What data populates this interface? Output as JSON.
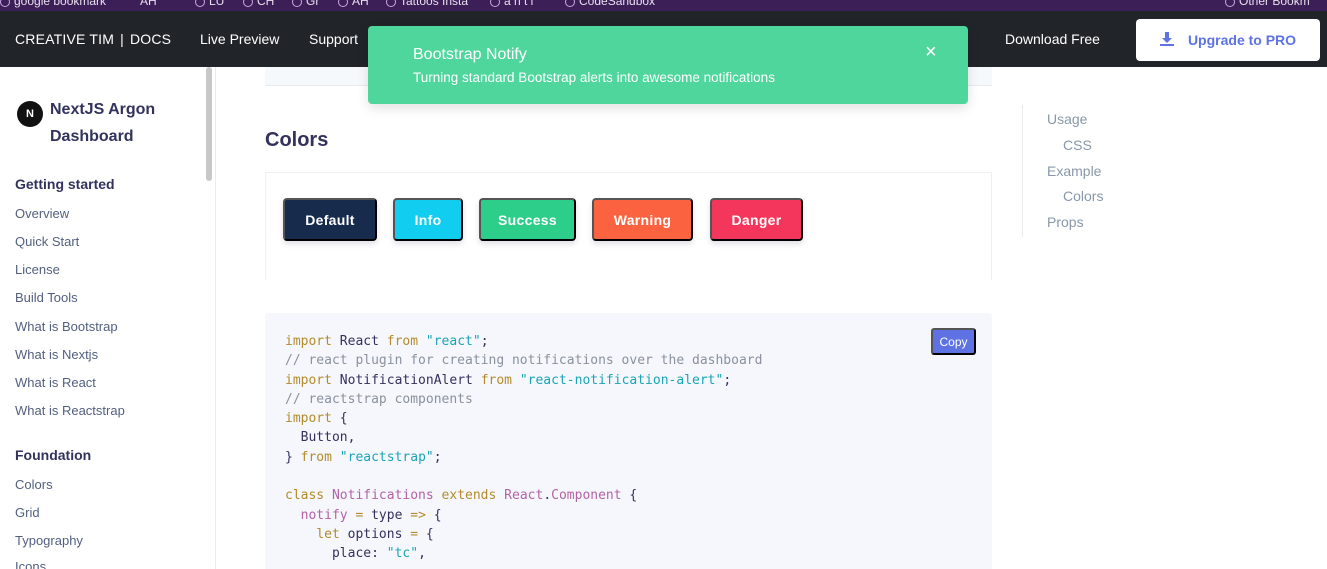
{
  "bookmarks": [
    {
      "label": "google bookmark"
    },
    {
      "label": "AH"
    },
    {
      "label": "LU"
    },
    {
      "label": "CH"
    },
    {
      "label": "Gr"
    },
    {
      "label": "AH"
    },
    {
      "label": "Tattoos Insta"
    },
    {
      "label": "a n t i"
    },
    {
      "label": "CodeSandbox"
    },
    {
      "label": "Other Bookm"
    }
  ],
  "navbar": {
    "brand": "CREATIVE TIM",
    "brand_separator": "|",
    "brand_docs": "DOCS",
    "links": [
      "Live Preview",
      "Support"
    ],
    "download_free": "Download Free",
    "upgrade": "Upgrade to PRO"
  },
  "sidebar": {
    "logo_letter": "N",
    "title": "NextJS Argon Dashboard",
    "sections": [
      {
        "heading": "Getting started",
        "items": [
          "Overview",
          "Quick Start",
          "License",
          "Build Tools",
          "What is Bootstrap",
          "What is Nextjs",
          "What is React",
          "What is Reactstrap"
        ]
      },
      {
        "heading": "Foundation",
        "items": [
          "Colors",
          "Grid",
          "Typography",
          "Icons"
        ]
      }
    ]
  },
  "main": {
    "section_title": "Colors",
    "buttons": [
      {
        "label": "Default",
        "color": "#172b4d"
      },
      {
        "label": "Info",
        "color": "#11cdef"
      },
      {
        "label": "Success",
        "color": "#2dce89"
      },
      {
        "label": "Warning",
        "color": "#fb6340"
      },
      {
        "label": "Danger",
        "color": "#f5365c"
      }
    ],
    "copy_label": "Copy",
    "code_lines": [
      "import React from \"react\";",
      "// react plugin for creating notifications over the dashboard",
      "import NotificationAlert from \"react-notification-alert\";",
      "// reactstrap components",
      "import {",
      "  Button,",
      "} from \"reactstrap\";",
      "",
      "class Notifications extends React.Component {",
      "  notify = type => {",
      "    let options = {",
      "      place: \"tc\","
    ]
  },
  "toc": {
    "items": [
      "Usage",
      "CSS",
      "Example",
      "Colors",
      "Props"
    ]
  },
  "notification": {
    "title": "Bootstrap Notify",
    "message": "Turning standard Bootstrap alerts into awesome notifications",
    "close": "×",
    "color": "#4fd69c"
  }
}
